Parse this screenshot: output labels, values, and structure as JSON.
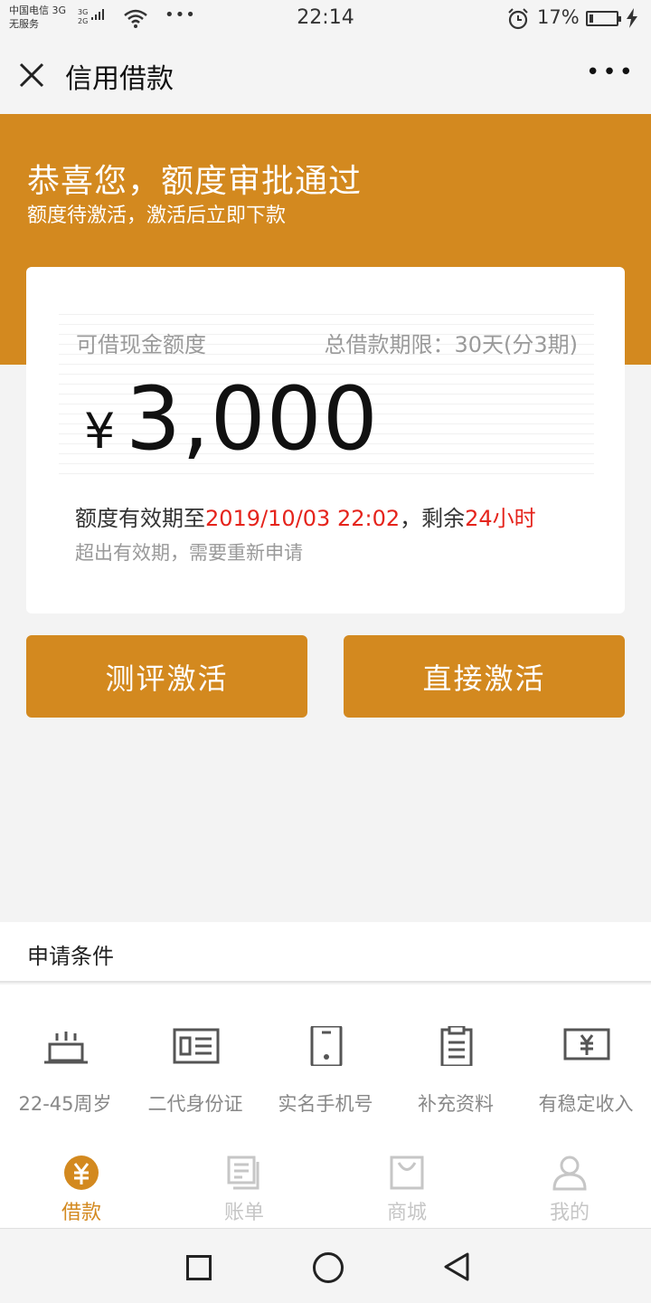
{
  "status_bar": {
    "carrier_line1": "中国电信 3G",
    "carrier_line2": "无服务",
    "net_top": "3G",
    "net_bottom": "2G",
    "more": "•••",
    "time": "22:14",
    "battery_percent": "17%",
    "battery_level": 0.17
  },
  "header": {
    "title": "信用借款",
    "menu": "•••",
    "close_icon": "close-icon"
  },
  "banner": {
    "title": "恭喜您，额度审批通过",
    "subtitle": "额度待激活，激活后立即下款"
  },
  "card": {
    "amount_label": "可借现金额度",
    "term_label": "总借款期限：30天(分3期)",
    "currency": "¥",
    "amount": "3,000",
    "validity_prefix": "额度有效期至",
    "validity_date": "2019/10/03 22:02",
    "validity_mid": "，剩余",
    "validity_remaining": "24小时",
    "expire_note": "超出有效期，需要重新申请"
  },
  "buttons": {
    "evaluate": "测评激活",
    "direct": "直接激活"
  },
  "conditions": {
    "title": "申请条件",
    "items": [
      {
        "label": "22-45周岁",
        "icon": "cake-icon"
      },
      {
        "label": "二代身份证",
        "icon": "id-card-icon"
      },
      {
        "label": "实名手机号",
        "icon": "phone-icon"
      },
      {
        "label": "补充资料",
        "icon": "clipboard-icon"
      },
      {
        "label": "有稳定收入",
        "icon": "income-icon"
      }
    ]
  },
  "tabs": [
    {
      "label": "借款",
      "icon": "loan-icon",
      "active": true
    },
    {
      "label": "账单",
      "icon": "bill-icon",
      "active": false
    },
    {
      "label": "商城",
      "icon": "shop-icon",
      "active": false
    },
    {
      "label": "我的",
      "icon": "profile-icon",
      "active": false
    }
  ],
  "colors": {
    "brand": "#d3891f",
    "highlight": "#e5241c",
    "inactive": "#c6c6c6"
  }
}
